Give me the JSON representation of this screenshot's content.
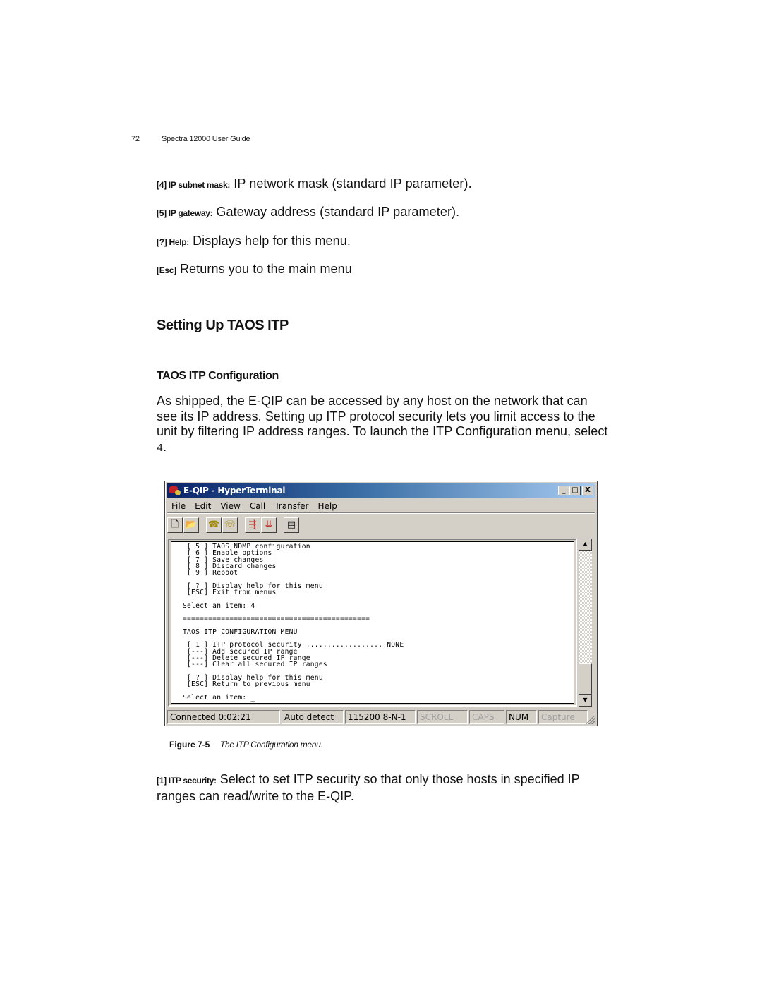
{
  "header": {
    "page_number": "72",
    "running_title": "Spectra 12000 User Guide"
  },
  "definitions_top": [
    {
      "key": "[4] IP subnet mask:",
      "text": " IP network mask (standard IP parameter)."
    },
    {
      "key": "[5] IP gateway:",
      "text": " Gateway address (standard IP parameter)."
    },
    {
      "key": "[?] Help:",
      "text": " Displays help for this menu."
    },
    {
      "key": "[Esc]",
      "text": " Returns you to the main menu"
    }
  ],
  "section": {
    "title": "Setting Up TAOS ITP",
    "subsection_title": "TAOS ITP Configuration",
    "paragraph_text": "As shipped, the E-QIP can be accessed by any host on the network that can see its IP address. Setting up ITP protocol security lets you limit access to the unit by filtering IP address ranges. To launch the ITP Configuration menu, select ",
    "paragraph_code": "4",
    "paragraph_end": "."
  },
  "window": {
    "title": "E-QIP - HyperTerminal",
    "controls": {
      "minimize": "_",
      "maximize": "□",
      "close": "X"
    },
    "menu": [
      "File",
      "Edit",
      "View",
      "Call",
      "Transfer",
      "Help"
    ],
    "toolbar": [
      {
        "name": "new-connection",
        "icon": "new-document-icon",
        "glyph": "🗋"
      },
      {
        "name": "open",
        "icon": "open-folder-icon",
        "glyph": "📂"
      },
      {
        "name": "call",
        "icon": "phone-icon",
        "glyph": "☎"
      },
      {
        "name": "disconnect",
        "icon": "hangup-phone-icon",
        "glyph": "☏"
      },
      {
        "name": "send",
        "icon": "send-file-icon",
        "glyph": "⇶"
      },
      {
        "name": "receive",
        "icon": "receive-file-icon",
        "glyph": "⇊"
      },
      {
        "name": "properties",
        "icon": "properties-icon",
        "glyph": "▤"
      }
    ],
    "terminal_lines": [
      "[ 5 ] TAOS NDMP configuration",
      "[ 6 ] Enable options",
      "[ 7 ] Save changes",
      "[ 8 ] Discard changes",
      "[ 9 ] Reboot",
      "",
      "[ ? ] Display help for this menu",
      "[ESC] Exit from menus",
      "",
      "Select an item: 4",
      "",
      "============================================",
      "",
      "TAOS ITP CONFIGURATION MENU",
      "",
      " [ 1 ] ITP protocol security .................. NONE",
      " [---] Add secured IP range",
      " [---] Delete secured IP range",
      " [---] Clear all secured IP ranges",
      "",
      " [ ? ] Display help for this menu",
      " [ESC] Return to previous menu",
      "",
      "Select an item: _"
    ],
    "scroll_up": "▲",
    "scroll_down": "▼",
    "status": [
      {
        "name": "connection-time",
        "text": "Connected 0:02:21",
        "dim": false
      },
      {
        "name": "emulation",
        "text": "Auto detect",
        "dim": false
      },
      {
        "name": "port-settings",
        "text": "115200 8-N-1",
        "dim": false
      },
      {
        "name": "scroll-lock",
        "text": "SCROLL",
        "dim": true
      },
      {
        "name": "caps-lock",
        "text": "CAPS",
        "dim": true
      },
      {
        "name": "num-lock",
        "text": "NUM",
        "dim": false
      },
      {
        "name": "capture",
        "text": "Capture",
        "dim": true
      }
    ]
  },
  "figure": {
    "label": "Figure 7-5",
    "caption": "The ITP Configuration menu."
  },
  "definitions_bottom": [
    {
      "key": "[1] ITP security:",
      "text": " Select to set ITP security so that only those hosts in specified IP ranges can read/write to the E-QIP."
    }
  ]
}
